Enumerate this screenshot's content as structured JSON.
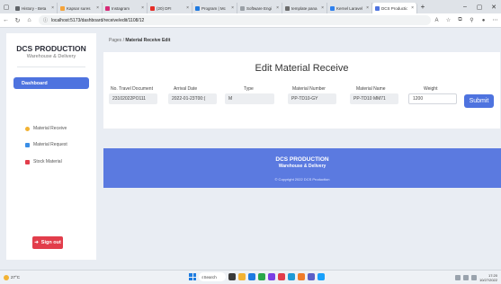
{
  "browser": {
    "tabs": [
      {
        "label": "History - Beta",
        "color": "#5f6368"
      },
      {
        "label": "Kapsar sures",
        "color": "#f4a33a"
      },
      {
        "label": "Instagram",
        "color": "#d62976"
      },
      {
        "label": "(20) DFI",
        "color": "#e52d27"
      },
      {
        "label": "Program | Mc",
        "color": "#1f7ae0"
      },
      {
        "label": "Software Engi",
        "color": "#9aa0a6"
      },
      {
        "label": "template pana",
        "color": "#6b6b6b"
      },
      {
        "label": "Kernel Laravel",
        "color": "#2f80ed"
      },
      {
        "label": "DCS Production",
        "color": "#4e73df"
      }
    ],
    "active_tab": 8,
    "url": "localhost:5173/dashboard/receive/edit/1108/12"
  },
  "sidebar": {
    "brand": "DCS PRODUCTION",
    "brand_sub": "Warehouse & Delivery",
    "dashboard_label": "Dashboard",
    "items": [
      {
        "label": "Material Receive",
        "color": "#f2b233"
      },
      {
        "label": "Material Request",
        "color": "#3a8ee6"
      },
      {
        "label": "Stock Material",
        "color": "#e23d4b"
      }
    ],
    "signout_label": "Sign out"
  },
  "breadcrumb": {
    "parent": "Pages",
    "separator": "/",
    "current": "Material Receive Edit"
  },
  "form": {
    "title": "Edit Material Receive",
    "fields": {
      "travel_doc": {
        "label": "No. Travel Document",
        "value": "23102022PO111"
      },
      "arrival_date": {
        "label": "Arrival Date",
        "value": "2022-01-23T00:("
      },
      "type": {
        "label": "Type",
        "value": "M"
      },
      "material_number": {
        "label": "Material Number",
        "value": "PP-TD10-GY"
      },
      "material_name": {
        "label": "Material Name",
        "value": "PP-TD10 MM71"
      },
      "weight": {
        "label": "Weight",
        "value": "1200"
      }
    },
    "submit_label": "Submit"
  },
  "footer": {
    "title": "DCS PRODUCTION",
    "subtitle": "Warehouse & Delivery",
    "copyright": "© Copyright 2022 DCS Production"
  },
  "taskbar": {
    "temp": "27°C",
    "search_label": "Search",
    "time": "17:20",
    "date": "10/27/2022"
  },
  "colors": {
    "accent": "#4e73df",
    "danger": "#e23d4b",
    "footer_bg": "#5b7ae0"
  }
}
